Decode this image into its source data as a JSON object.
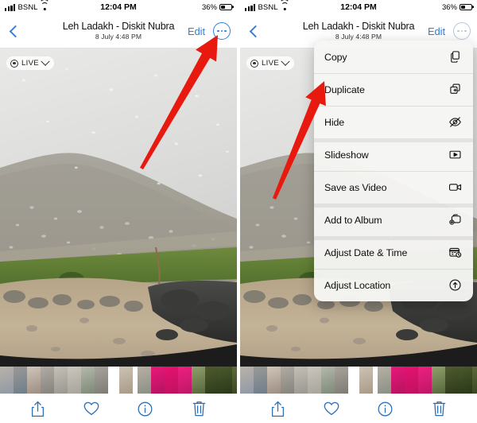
{
  "status_bar": {
    "carrier": "BSNL",
    "time": "12:04 PM",
    "battery_percent": "36%",
    "signal_icon": "signal-bars-icon",
    "wifi_icon": "wifi-icon",
    "battery_icon": "battery-icon"
  },
  "nav_bar": {
    "back_icon": "chevron-left-icon",
    "title": "Leh Ladakh - Diskit Nubra",
    "subtitle": "8 July  4:48 PM",
    "edit_label": "Edit",
    "more_icon": "ellipsis-circle-icon"
  },
  "photo": {
    "live_badge": {
      "icon": "live-photo-icon",
      "label": "LIVE",
      "chevron_icon": "chevron-down-icon"
    },
    "description": "Misty mountain slope behind a rain-speckled window, rubble and dirt road in foreground"
  },
  "toolbar": {
    "items": [
      {
        "name": "share-button",
        "icon": "share-icon"
      },
      {
        "name": "favorite-button",
        "icon": "heart-icon"
      },
      {
        "name": "info-button",
        "icon": "info-circle-icon"
      },
      {
        "name": "delete-button",
        "icon": "trash-icon"
      }
    ]
  },
  "context_menu": {
    "items": [
      {
        "label": "Copy",
        "icon": "copy-icon",
        "group_start": false
      },
      {
        "label": "Duplicate",
        "icon": "duplicate-icon",
        "group_start": false
      },
      {
        "label": "Hide",
        "icon": "eye-slash-icon",
        "group_start": false
      },
      {
        "label": "Slideshow",
        "icon": "play-rectangle-icon",
        "group_start": true
      },
      {
        "label": "Save as Video",
        "icon": "video-camera-icon",
        "group_start": false
      },
      {
        "label": "Add to Album",
        "icon": "add-to-album-icon",
        "group_start": true
      },
      {
        "label": "Adjust Date & Time",
        "icon": "calendar-clock-icon",
        "group_start": true
      },
      {
        "label": "Adjust Location",
        "icon": "location-arrow-circle-icon",
        "group_start": false
      }
    ]
  },
  "annotations": {
    "arrow_color": "#e8190f",
    "left_arrow_target": "ellipsis-circle-icon",
    "right_arrow_target": "Duplicate"
  },
  "filmstrip": {
    "thumbnails": [
      {
        "c1": "#b9b2a8",
        "c2": "#8f99a6",
        "w": 17
      },
      {
        "c1": "#9a9a96",
        "c2": "#6f7d8c",
        "w": 17
      },
      {
        "c1": "#cfc6bb",
        "c2": "#9e8d82",
        "w": 17
      },
      {
        "c1": "#b0aca4",
        "c2": "#86837c",
        "w": 17
      },
      {
        "c1": "#c4c0b8",
        "c2": "#9a9790",
        "w": 17
      },
      {
        "c1": "#cac6be",
        "c2": "#a7a49c",
        "w": 17
      },
      {
        "c1": "#b4b8ac",
        "c2": "#7e8a78",
        "w": 17
      },
      {
        "c1": "#a8a49c",
        "c2": "#7d7b74",
        "w": 17
      },
      {
        "c1": "#ffffff",
        "c2": "#ffffff",
        "w": 14
      },
      {
        "c1": "#cdc3b4",
        "c2": "#a89a88",
        "w": 17
      },
      {
        "c1": "#ffffff",
        "c2": "#ffffff",
        "w": 6
      },
      {
        "c1": "#b8b0a4",
        "c2": "#8a8f84",
        "w": 17
      },
      {
        "c1": "#e8187a",
        "c2": "#b51460",
        "w": 17
      },
      {
        "c1": "#e4136f",
        "c2": "#c01160",
        "w": 17
      },
      {
        "c1": "#ec2080",
        "c2": "#bf1766",
        "w": 17
      },
      {
        "c1": "#8fa06a",
        "c2": "#56683c",
        "w": 17
      },
      {
        "c1": "#4e5c2e",
        "c2": "#2e3a1c",
        "w": 17
      },
      {
        "c1": "#4a5a2c",
        "c2": "#2b3718",
        "w": 17
      },
      {
        "c1": "#5d6b3a",
        "c2": "#36421f",
        "w": 17
      },
      {
        "c1": "#b3a99c",
        "c2": "#7c7368",
        "w": 17
      }
    ]
  }
}
